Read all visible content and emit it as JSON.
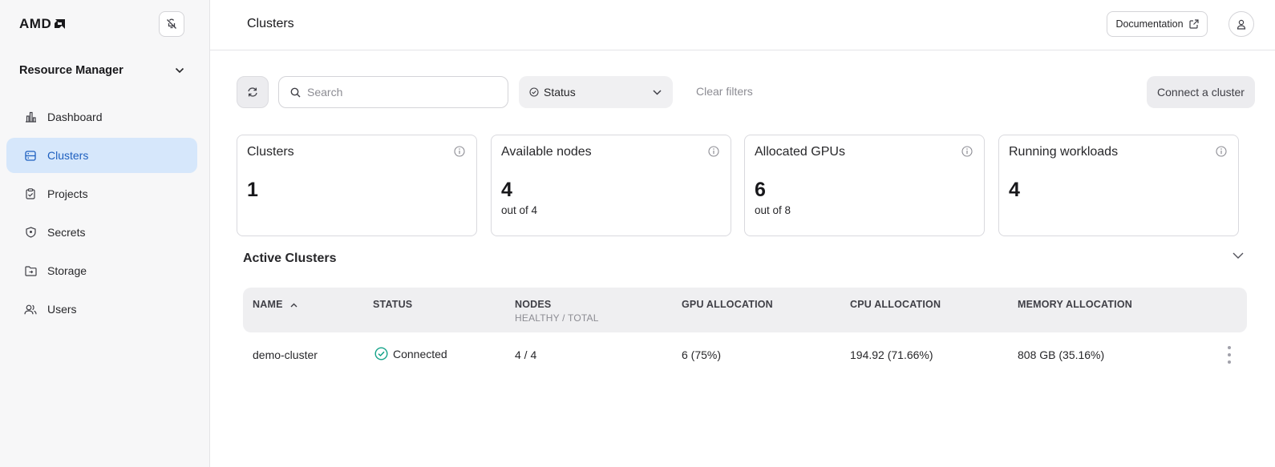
{
  "brand": {
    "logo_text": "AMD"
  },
  "sidebar": {
    "workspace": "Resource Manager",
    "items": [
      {
        "label": "Dashboard",
        "icon": "bar-chart-icon"
      },
      {
        "label": "Clusters",
        "icon": "server-icon",
        "active": true
      },
      {
        "label": "Projects",
        "icon": "clipboard-icon"
      },
      {
        "label": "Secrets",
        "icon": "shield-icon"
      },
      {
        "label": "Storage",
        "icon": "folder-icon"
      },
      {
        "label": "Users",
        "icon": "users-icon"
      }
    ]
  },
  "header": {
    "title": "Clusters",
    "documentation_label": "Documentation"
  },
  "toolbar": {
    "search_placeholder": "Search",
    "status_label": "Status",
    "clear_filters_label": "Clear filters",
    "connect_label": "Connect a cluster"
  },
  "stats": [
    {
      "title": "Clusters",
      "value": "1",
      "sub": ""
    },
    {
      "title": "Available nodes",
      "value": "4",
      "sub": "out of 4"
    },
    {
      "title": "Allocated GPUs",
      "value": "6",
      "sub": "out of 8"
    },
    {
      "title": "Running workloads",
      "value": "4",
      "sub": ""
    }
  ],
  "active_clusters": {
    "title": "Active Clusters",
    "columns": {
      "name": "NAME",
      "status": "STATUS",
      "nodes": "NODES",
      "nodes_sub": "HEALTHY / TOTAL",
      "gpu": "GPU ALLOCATION",
      "cpu": "CPU ALLOCATION",
      "memory": "MEMORY ALLOCATION"
    },
    "rows": [
      {
        "name": "demo-cluster",
        "status": "Connected",
        "nodes": "4 / 4",
        "gpu": "6 (75%)",
        "cpu": "194.92 (71.66%)",
        "memory": "808 GB (35.16%)"
      }
    ]
  },
  "colors": {
    "accent": "#1d5fbf",
    "active_bg": "#d6e7fb",
    "connected": "#14a389"
  }
}
